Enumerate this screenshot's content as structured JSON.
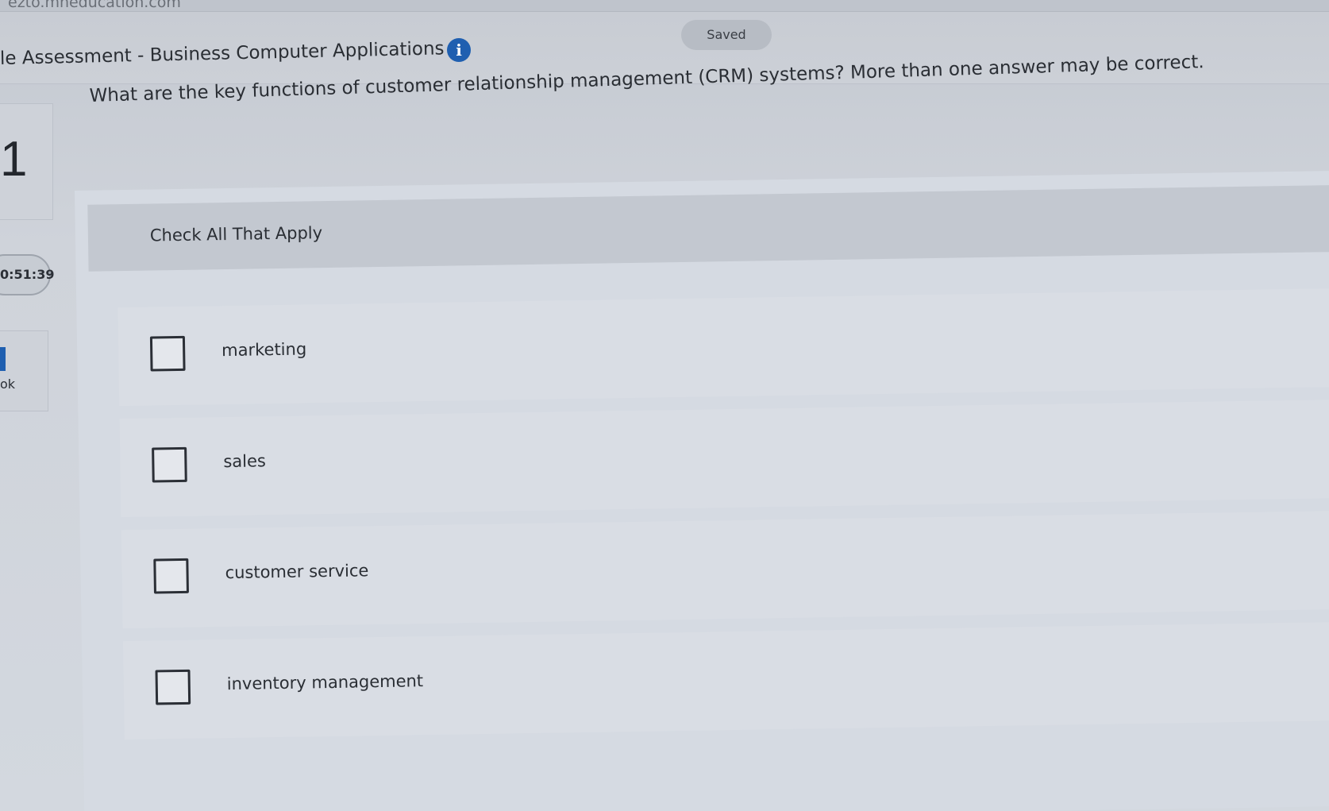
{
  "browser": {
    "url_fragment": "ezto.mheducation.com"
  },
  "header": {
    "title": "le Assessment - Business Computer Applications",
    "info_icon": "info-circle-icon",
    "saved_label": "Saved"
  },
  "sidebar": {
    "question_number": "1",
    "timer": "0:51:39",
    "ebook_icon": "book-icon",
    "ebook_label": "ok"
  },
  "question": {
    "prompt": "What are the key functions of customer relationship management (CRM) systems? More than one answer may be correct.",
    "instruction": "Check All That Apply",
    "options": [
      {
        "label": "marketing",
        "checked": false
      },
      {
        "label": "sales",
        "checked": false
      },
      {
        "label": "customer service",
        "checked": false
      },
      {
        "label": "inventory management",
        "checked": false
      }
    ]
  },
  "colors": {
    "accent": "#1f5fb0",
    "background": "#d3d8df"
  }
}
